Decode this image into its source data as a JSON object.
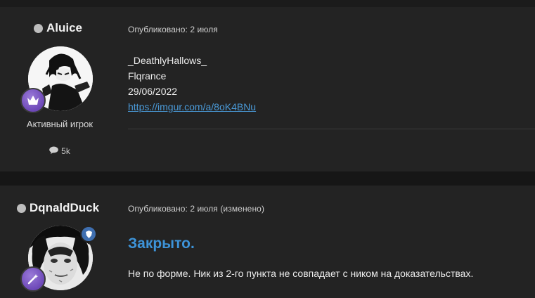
{
  "posts": [
    {
      "author": {
        "name": "Aluice",
        "status_color": "#bdbdbd",
        "avatar_icon": "anime-character-avatar",
        "rank_icon": "crown-badge-icon",
        "rank_title": "Активный игрок",
        "stats_icon": "speech-bubble-icon",
        "post_count": "5k"
      },
      "meta": "Опубликовано: 2 июля",
      "lines": [
        "_DeathlyHallows_",
        "Flqrance",
        "29/06/2022"
      ],
      "link": "https://imgur.com/a/8oK4BNu"
    },
    {
      "author": {
        "name": "DqnaldDuck",
        "status_color": "#bdbdbd",
        "avatar_icon": "grayscale-face-avatar",
        "rank_icon": "sparkle-badge-icon",
        "mod_icon": "shield-icon"
      },
      "meta": "Опубликовано: 2 июля (изменено)",
      "title": "Закрыто.",
      "reason": "Не по форме. Ник из 2-го пункта не совпадает с ником на доказательствах."
    }
  ]
}
